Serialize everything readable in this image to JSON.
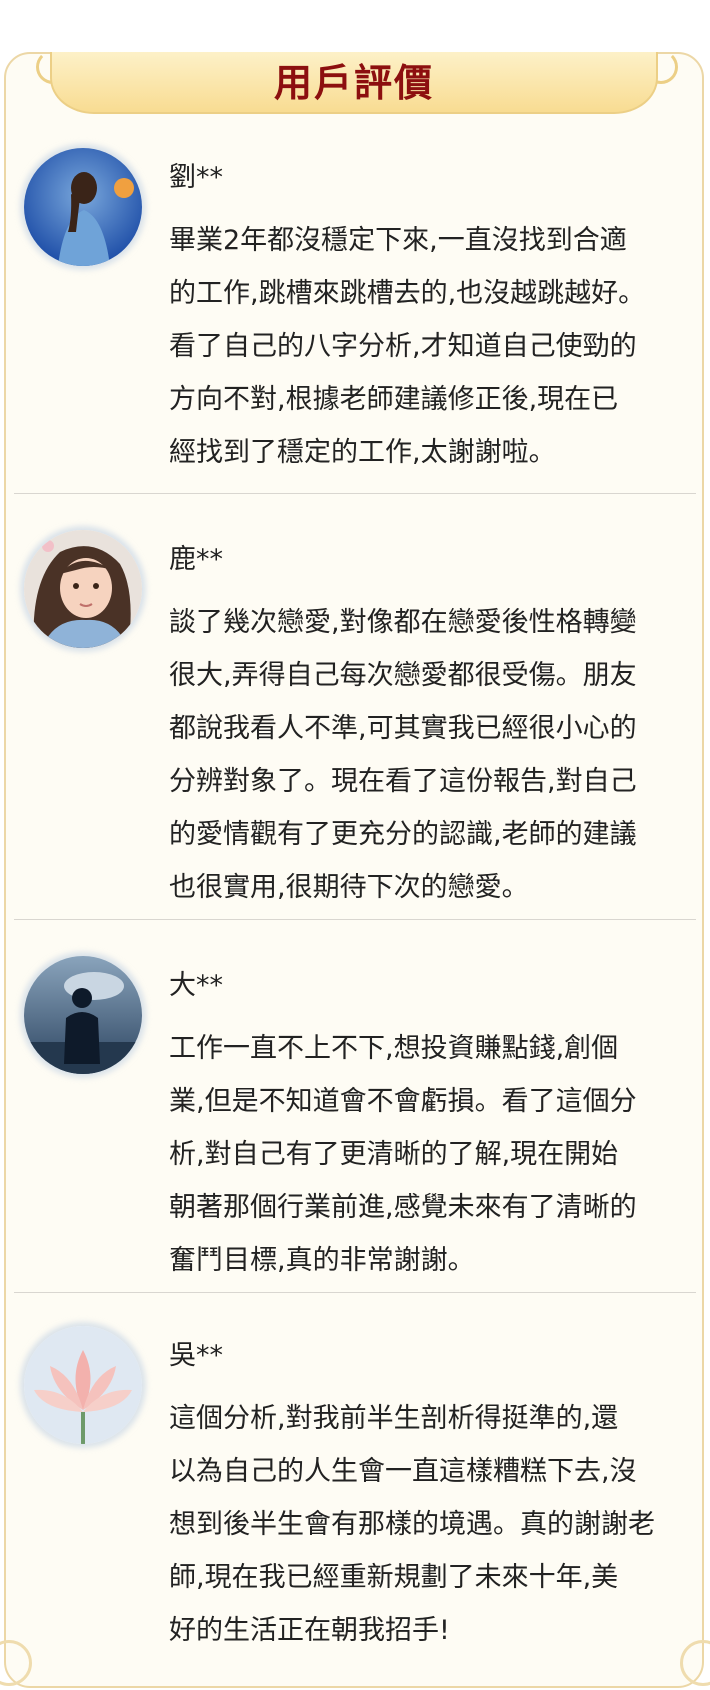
{
  "header": {
    "title": "用戶評價"
  },
  "reviews": [
    {
      "name": "劉**",
      "text": "畢業2年都沒穩定下來,一直沒找到合適\n的工作,跳槽來跳槽去的,也沒越跳越好。\n看了自己的八字分析,才知道自己使勁的\n方向不對,根據老師建議修正後,現在已\n經找到了穩定的工作,太謝謝啦。"
    },
    {
      "name": "鹿**",
      "text": "談了幾次戀愛,對像都在戀愛後性格轉變\n很大,弄得自己每次戀愛都很受傷。朋友\n都說我看人不準,可其實我已經很小心的\n分辨對象了。現在看了這份報告,對自己\n的愛情觀有了更充分的認識,老師的建議\n也很實用,很期待下次的戀愛。"
    },
    {
      "name": "大**",
      "text": "工作一直不上不下,想投資賺點錢,創個\n業,但是不知道會不會虧損。看了這個分\n析,對自己有了更清晰的了解,現在開始\n朝著那個行業前進,感覺未來有了清晰的\n奮鬥目標,真的非常謝謝。"
    },
    {
      "name": "吳**",
      "text": "這個分析,對我前半生剖析得挺準的,還\n以為自己的人生會一直這樣糟糕下去,沒\n想到後半生會有那樣的境遇。真的謝謝老\n師,現在我已經重新規劃了未來十年,美\n好的生活正在朝我招手!"
    }
  ],
  "colors": {
    "card_background": "#fefcf4",
    "banner_gold": "#f8dc92",
    "title_red": "#8c0f0f",
    "body_text": "#222222"
  }
}
